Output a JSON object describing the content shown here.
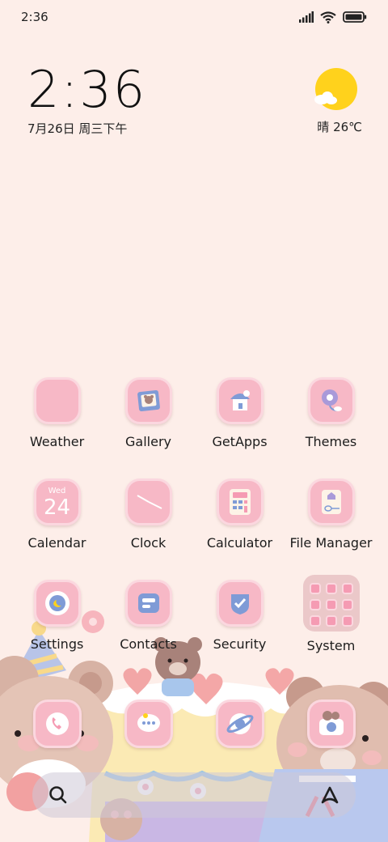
{
  "status_bar": {
    "time": "2:36"
  },
  "clock_widget": {
    "time": "2:36",
    "date": "7月26日 周三下午"
  },
  "weather_widget": {
    "text": "晴 26℃",
    "icon": "sunny-cloud-icon"
  },
  "apps": [
    {
      "label": "Weather",
      "icon": "weather-icon"
    },
    {
      "label": "Gallery",
      "icon": "gallery-icon"
    },
    {
      "label": "GetApps",
      "icon": "getapps-icon"
    },
    {
      "label": "Themes",
      "icon": "themes-icon"
    },
    {
      "label": "Calendar",
      "icon": "calendar-icon",
      "day_name": "Wed",
      "day_number": "24"
    },
    {
      "label": "Clock",
      "icon": "clock-icon"
    },
    {
      "label": "Calculator",
      "icon": "calculator-icon"
    },
    {
      "label": "File Manager",
      "icon": "file-manager-icon"
    },
    {
      "label": "Settings",
      "icon": "settings-icon"
    },
    {
      "label": "Contacts",
      "icon": "contacts-icon"
    },
    {
      "label": "Security",
      "icon": "security-icon"
    },
    {
      "label": "System",
      "icon": "folder-icon"
    }
  ],
  "dock": [
    {
      "icon": "phone-icon"
    },
    {
      "icon": "messages-icon"
    },
    {
      "icon": "browser-icon"
    },
    {
      "icon": "camera-icon"
    }
  ],
  "search_bar": {
    "left_icon": "search-icon",
    "right_icon": "assistant-icon"
  },
  "colors": {
    "background": "#fdeee9",
    "icon_pink": "#f59bb3",
    "icon_border": "#fbd7df",
    "sun": "#ffd21c",
    "accent_blue": "#7f9bd6"
  }
}
